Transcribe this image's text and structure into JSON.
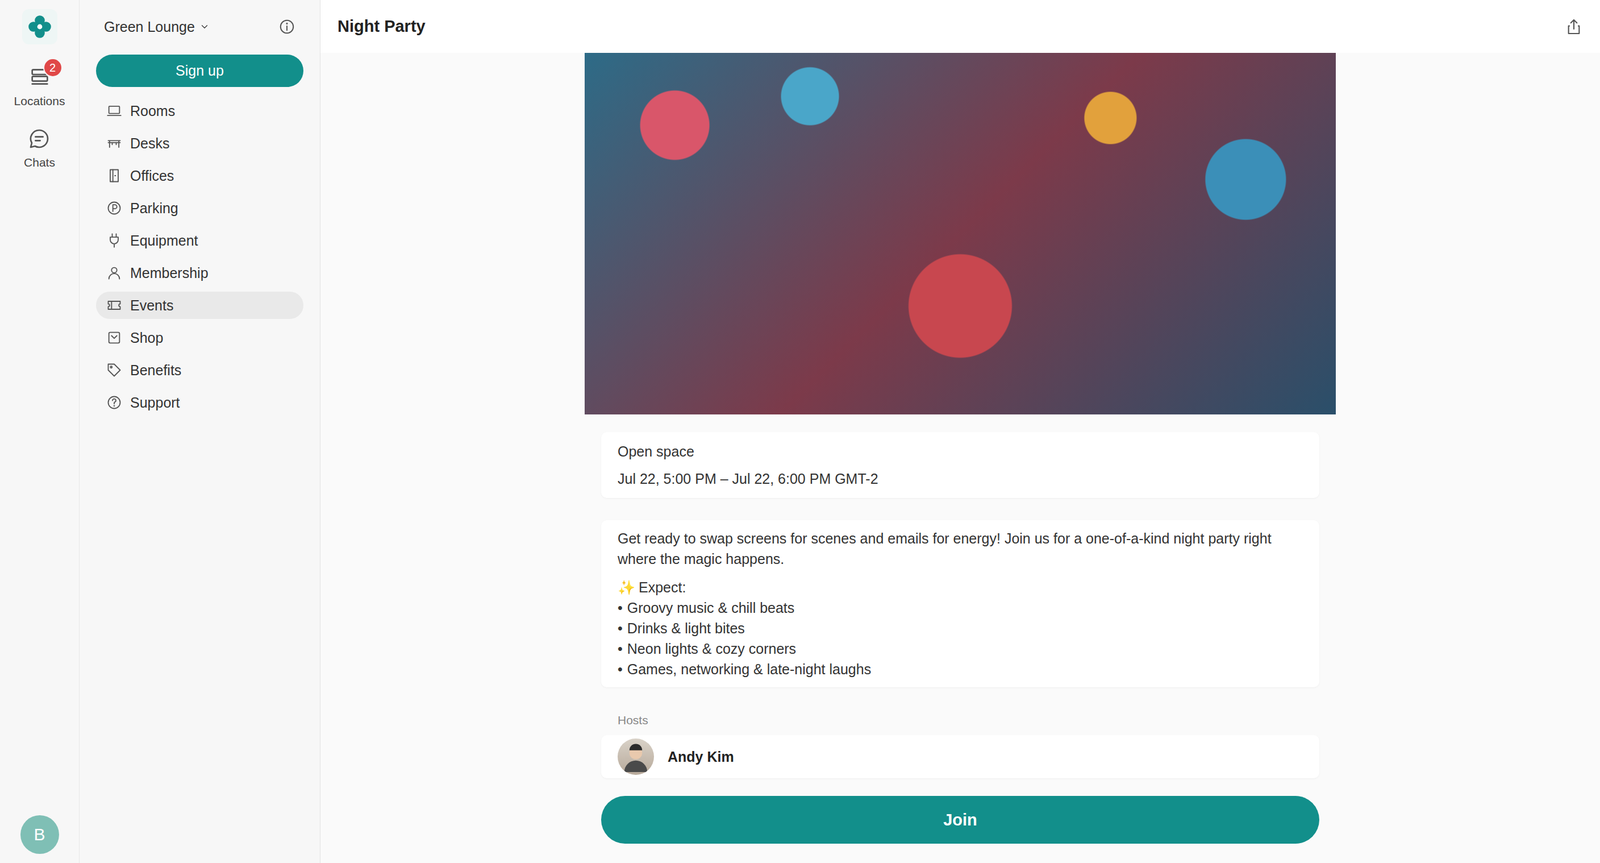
{
  "rail": {
    "items": [
      {
        "label": "Locations",
        "badge": "2",
        "selected": false
      },
      {
        "label": "Chats",
        "selected": false
      }
    ],
    "user": {
      "initial": "B"
    }
  },
  "sidebar": {
    "location": "Green Lounge",
    "signup": "Sign up",
    "items": [
      {
        "label": "Rooms",
        "selected": false
      },
      {
        "label": "Desks",
        "selected": false
      },
      {
        "label": "Offices",
        "selected": false
      },
      {
        "label": "Parking",
        "selected": false
      },
      {
        "label": "Equipment",
        "selected": false
      },
      {
        "label": "Membership",
        "selected": false
      },
      {
        "label": "Events",
        "selected": true
      },
      {
        "label": "Shop",
        "selected": false
      },
      {
        "label": "Benefits",
        "selected": false
      },
      {
        "label": "Support",
        "selected": false
      }
    ]
  },
  "event": {
    "title": "Night Party",
    "place": "Open space",
    "time": "Jul 22, 5:00 PM – Jul 22, 6:00 PM GMT-2",
    "description": "Get ready to swap screens for scenes and emails for energy! Join us for a one-of-a-kind night party right where the magic happens.",
    "expect": {
      "icon": "✨",
      "label": "Expect:"
    },
    "bullet": "•",
    "bullets": [
      "Groovy music & chill beats",
      "Drinks & light bites",
      "Neon lights & cozy corners",
      "Games, networking & late-night laughs"
    ],
    "hosts_label": "Hosts",
    "hosts": [
      {
        "name": "Andy Kim"
      }
    ],
    "join": "Join"
  }
}
